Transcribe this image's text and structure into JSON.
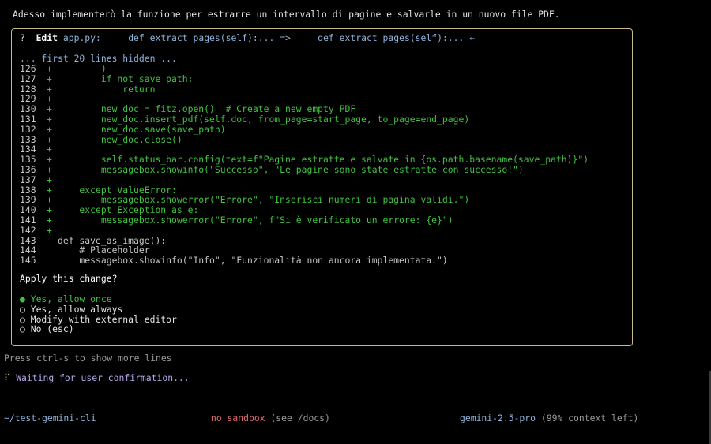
{
  "intro_text": "Adesso implementerò la funzione per estrarre un intervallo di pagine e salvarle in un nuovo file PDF.",
  "dialog": {
    "prefix": "?",
    "tool_name": "Edit",
    "file": "app.py:",
    "old_snippet": "def extract_pages(self):... =>",
    "new_snippet": "def extract_pages(self):... ←",
    "hidden_note": "... first 20 lines hidden ...",
    "diff_lines": [
      {
        "num": "126",
        "marker": "+",
        "text": "        )",
        "type": "added"
      },
      {
        "num": "127",
        "marker": "+",
        "text": "        if not save_path:",
        "type": "added"
      },
      {
        "num": "128",
        "marker": "+",
        "text": "            return",
        "type": "added"
      },
      {
        "num": "129",
        "marker": "+",
        "text": "",
        "type": "added"
      },
      {
        "num": "130",
        "marker": "+",
        "text": "        new_doc = fitz.open()  # Create a new empty PDF",
        "type": "added"
      },
      {
        "num": "131",
        "marker": "+",
        "text": "        new_doc.insert_pdf(self.doc, from_page=start_page, to_page=end_page)",
        "type": "added"
      },
      {
        "num": "132",
        "marker": "+",
        "text": "        new_doc.save(save_path)",
        "type": "added"
      },
      {
        "num": "133",
        "marker": "+",
        "text": "        new_doc.close()",
        "type": "added"
      },
      {
        "num": "134",
        "marker": "+",
        "text": "",
        "type": "added"
      },
      {
        "num": "135",
        "marker": "+",
        "text": "        self.status_bar.config(text=f\"Pagine estratte e salvate in {os.path.basename(save_path)}\")",
        "type": "added"
      },
      {
        "num": "136",
        "marker": "+",
        "text": "        messagebox.showinfo(\"Successo\", \"Le pagine sono state estratte con successo!\")",
        "type": "added"
      },
      {
        "num": "137",
        "marker": "+",
        "text": "",
        "type": "added"
      },
      {
        "num": "138",
        "marker": "+",
        "text": "    except ValueError:",
        "type": "added"
      },
      {
        "num": "139",
        "marker": "+",
        "text": "        messagebox.showerror(\"Errore\", \"Inserisci numeri di pagina validi.\")",
        "type": "added"
      },
      {
        "num": "140",
        "marker": "+",
        "text": "    except Exception as e:",
        "type": "added"
      },
      {
        "num": "141",
        "marker": "+",
        "text": "        messagebox.showerror(\"Errore\", f\"Si è verificato un errore: {e}\")",
        "type": "added"
      },
      {
        "num": "142",
        "marker": "+",
        "text": "",
        "type": "added"
      },
      {
        "num": "143",
        "marker": "",
        "text": "def save_as_image():",
        "type": "context"
      },
      {
        "num": "144",
        "marker": "",
        "text": "    # Placeholder",
        "type": "context"
      },
      {
        "num": "145",
        "marker": "",
        "text": "    messagebox.showinfo(\"Info\", \"Funzionalità non ancora implementata.\")",
        "type": "context"
      }
    ],
    "question": "Apply this change?",
    "options": [
      {
        "bullet": "●",
        "label": "Yes, allow once",
        "selected": true
      },
      {
        "bullet": "○",
        "label": "Yes, allow always",
        "selected": false
      },
      {
        "bullet": "○",
        "label": "Modify with external editor",
        "selected": false
      },
      {
        "bullet": "○",
        "label": "No (esc)",
        "selected": false
      }
    ]
  },
  "press_hint": "Press ctrl-s to show more lines",
  "status": {
    "spinner": "⠏",
    "text": "Waiting for user confirmation..."
  },
  "footer": {
    "cwd": "~/test-gemini-cli",
    "sandbox": "no sandbox",
    "sandbox_hint": "(see /docs)",
    "model": "gemini-2.5-pro",
    "context": "(99% context left)"
  },
  "colors": {
    "background": "#000000",
    "added": "#41c241",
    "accent_blue": "#8fb3d9",
    "border": "#c8b98a",
    "sandbox_red": "#e06c75",
    "status_purple": "#b8a7e8"
  }
}
